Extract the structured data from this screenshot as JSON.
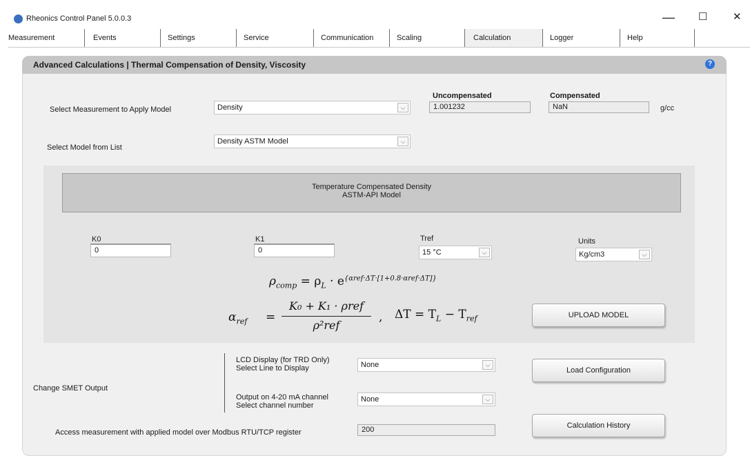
{
  "window": {
    "title": "Rheonics Control Panel 5.0.0.3",
    "minimize": "—",
    "maximize": "☐",
    "close": "✕"
  },
  "tabs": [
    {
      "label": "Measurement"
    },
    {
      "label": "Events"
    },
    {
      "label": "Settings"
    },
    {
      "label": "Service"
    },
    {
      "label": "Communication"
    },
    {
      "label": "Scaling"
    },
    {
      "label": "Calculation",
      "active": true
    },
    {
      "label": "Logger"
    },
    {
      "label": "Help"
    }
  ],
  "panel": {
    "title": "Advanced Calculations | Thermal Compensation of Density, Viscosity",
    "help_icon": "?"
  },
  "measurement": {
    "label": "Select Measurement to Apply Model",
    "selected": "Density",
    "uncompensated_label": "Uncompensated",
    "uncompensated_value": "1.001232",
    "compensated_label": "Compensated",
    "compensated_value": "NaN",
    "unit": "g/cc"
  },
  "model": {
    "label": "Select Model from List",
    "selected": "Density ASTM Model"
  },
  "model_info": {
    "line1": "Temperature Compensated Density",
    "line2": "ASTM-API Model"
  },
  "params": {
    "k0_label": "K0",
    "k0_value": "0",
    "k1_label": "K1",
    "k1_value": "0",
    "tref_label": "Tref",
    "tref_value": "15 °C",
    "units_label": "Units",
    "units_value": "Kg/cm3"
  },
  "formulas": {
    "rho_comp_lhs": "ρ",
    "rho_comp_lhs_sub": "comp",
    "rho_comp_mid": " = ρ",
    "rho_comp_mid_sub": "L",
    "rho_comp_dot": " · e",
    "rho_comp_exp": "{αref·ΔT·[1+0.8·αref·ΔT]}",
    "alpha_lhs": "α",
    "alpha_lhs_sub": "ref",
    "alpha_eq": "=",
    "alpha_num": "K₀ + K₁ · ρref",
    "alpha_den": "ρ²ref",
    "comma": ",",
    "delta_t": "ΔT = T",
    "delta_t_sub1": "L",
    "delta_t_minus": " − T",
    "delta_t_sub2": "ref"
  },
  "buttons": {
    "upload": "UPLOAD MODEL",
    "load_config": "Load Configuration",
    "history": "Calculation History"
  },
  "smet": {
    "label": "Change SMET Output",
    "lcd_label_1": "LCD Display (for TRD Only)",
    "lcd_label_2": "Select Line to Display",
    "lcd_value": "None",
    "output_label_1": "Output on 4-20 mA channel",
    "output_label_2": "Select channel number",
    "output_value": "None"
  },
  "modbus": {
    "label": "Access measurement with applied model over Modbus RTU/TCP register",
    "value": "200"
  },
  "icons": {
    "dropdown": "chevron-down-icon",
    "logo": "rheonics-logo-icon",
    "help": "help-icon"
  }
}
